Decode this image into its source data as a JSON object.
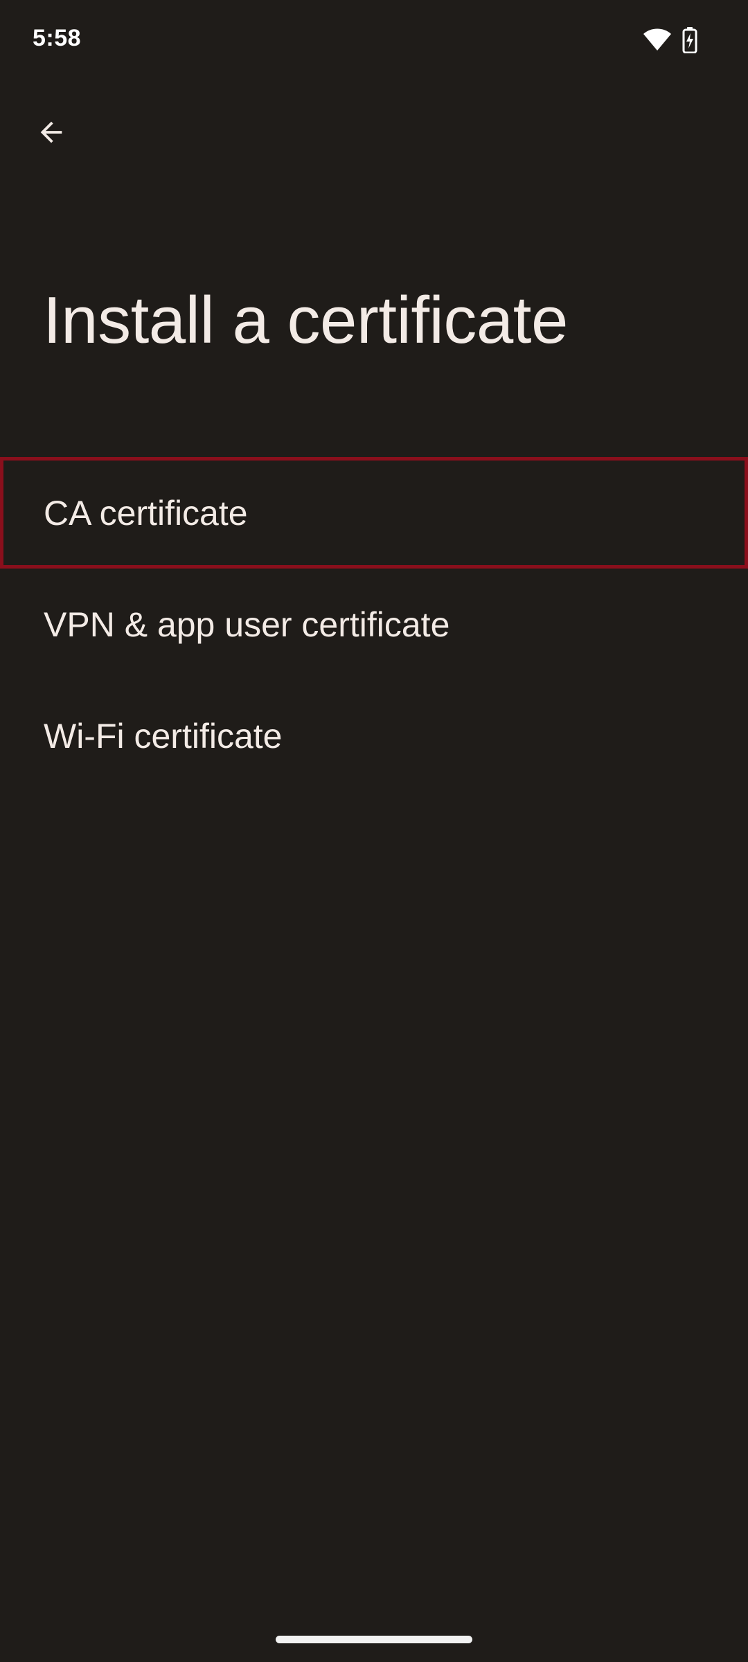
{
  "status_bar": {
    "time": "5:58",
    "icons": [
      "wifi-icon",
      "battery-charging-icon"
    ]
  },
  "app_bar": {
    "back_icon": "arrow-back-icon"
  },
  "page": {
    "title": "Install a certificate"
  },
  "list": {
    "items": [
      {
        "label": "CA certificate",
        "highlighted": true
      },
      {
        "label": "VPN & app user certificate",
        "highlighted": false
      },
      {
        "label": "Wi-Fi certificate",
        "highlighted": false
      }
    ]
  },
  "colors": {
    "background": "#1f1c19",
    "text": "#f3ebe6",
    "highlight_border": "#8a0f1c"
  }
}
